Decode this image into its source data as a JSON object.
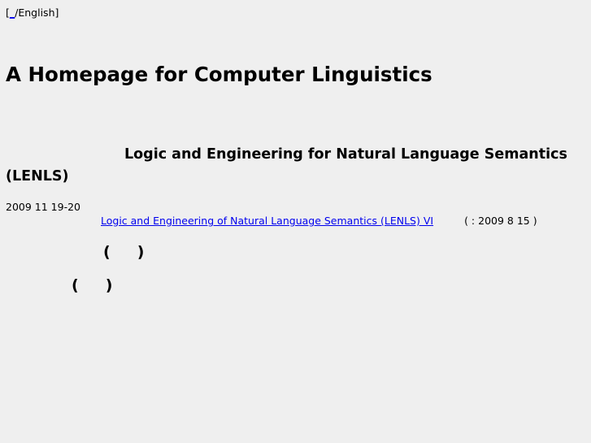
{
  "lang_bar": {
    "open_bracket": "[",
    "link_text": "_",
    "english_label": "/English]"
  },
  "site_title": "A Homepage for Computer Linguistics",
  "section_heading": "Logic and Engineering for Natural Language Semantics (LENLS)",
  "event": {
    "date": "2009 11 19-20",
    "link_text": "Logic and Engineering of Natural Language Semantics (LENLS) VI",
    "note": "(      : 2009 8 15 )"
  },
  "paren_1": "(     )",
  "paren_2": "(     )"
}
